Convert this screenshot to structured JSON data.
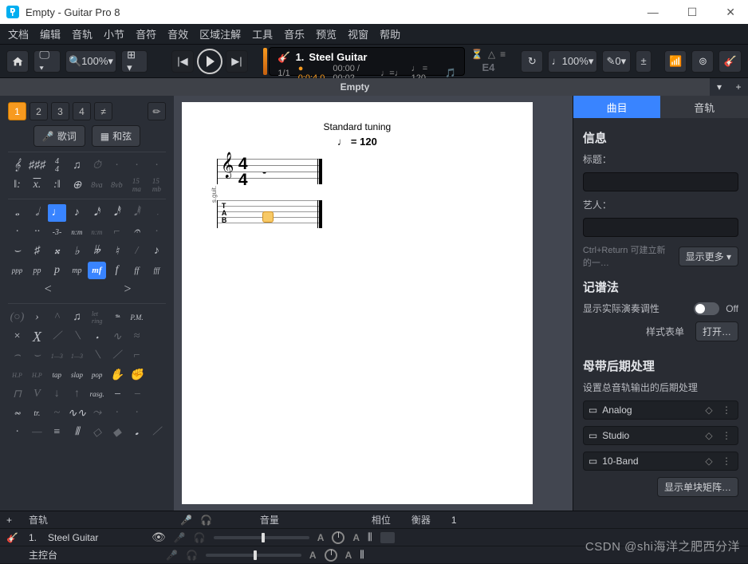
{
  "window": {
    "title": "Empty - Guitar Pro 8"
  },
  "menu": [
    "文档",
    "编辑",
    "音轨",
    "小节",
    "音符",
    "音效",
    "区域注解",
    "工具",
    "音乐",
    "预览",
    "视窗",
    "帮助"
  ],
  "toolbar": {
    "zoom": "100%",
    "track_number": "1.",
    "track_name": "Steel Guitar",
    "bar_pos": "1/1",
    "duration": "0:0:4.0",
    "time": "00:00 / 00:02",
    "tempo_note": "♩=♩",
    "tempo": "♩ = 120",
    "chord": "E4",
    "loop_pct": "100%",
    "pen": "0"
  },
  "doc_tab": "Empty",
  "voices": [
    "1",
    "2",
    "3",
    "4"
  ],
  "lyrics_btn": "歌词",
  "chord_btn": "和弦",
  "score": {
    "tuning": "Standard tuning",
    "tempo": "= 120",
    "track_label": "s.guit.",
    "timesig_top": "4",
    "timesig_bot": "4"
  },
  "side": {
    "tab_song": "曲目",
    "tab_track": "音轨",
    "info_title": "信息",
    "label_title": "标题：",
    "label_artist": "艺人：",
    "hint": "Ctrl+Return 可建立新的一…",
    "more": "显示更多",
    "notation_title": "记谱法",
    "show_tonality": "显示实际演奏调性",
    "toggle_state": "Off",
    "stylesheet": "样式表单",
    "open": "打开…",
    "mastering_title": "母带后期处理",
    "mastering_sub": "设置总音轨输出的后期处理",
    "presets": [
      "Analog",
      "Studio",
      "10-Band"
    ],
    "matrix_btn": "显示单块矩阵…"
  },
  "bottom": {
    "track_label": "音轨",
    "volume_label": "音量",
    "pan_label": "相位",
    "eq_label": "衡器",
    "track1_num": "1.",
    "track1_name": "Steel Guitar",
    "console": "主控台",
    "auto_a": "A",
    "one": "1"
  },
  "watermark": "CSDN @shi海洋之肥西分洋"
}
